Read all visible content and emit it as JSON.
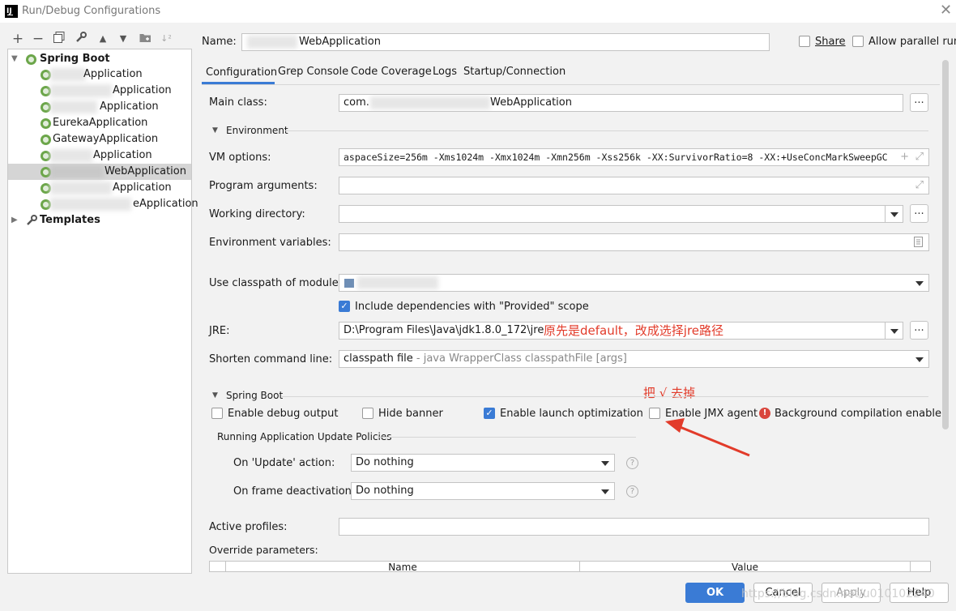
{
  "window": {
    "title": "Run/Debug Configurations"
  },
  "toolbar": {
    "add": "+",
    "remove": "−",
    "copy": "⧉",
    "edit": "🔧",
    "up": "▲",
    "down": "▼",
    "folder": "📁",
    "sort": "↓²"
  },
  "tree": {
    "spring_boot": "Spring Boot",
    "templates": "Templates",
    "items": [
      {
        "label": "Application"
      },
      {
        "label": "Application"
      },
      {
        "label": "Application"
      },
      {
        "label": "EurekaApplication"
      },
      {
        "label": "GatewayApplication"
      },
      {
        "label": "Application"
      },
      {
        "label": "WebApplication"
      },
      {
        "label": "Application"
      },
      {
        "label": "eApplication"
      }
    ]
  },
  "header": {
    "name_label": "Name:",
    "name_value": "WebApplication",
    "share_label": "Share",
    "parallel_label": "Allow parallel run"
  },
  "tabs": [
    "Configuration",
    "Grep Console",
    "Code Coverage",
    "Logs",
    "Startup/Connection"
  ],
  "form": {
    "main_class_label": "Main class:",
    "main_class_prefix": "com.",
    "main_class_suffix": "WebApplication",
    "environment_section": "Environment",
    "vm_options_label": "VM options:",
    "vm_options_value": "aspaceSize=256m -Xms1024m -Xmx1024m -Xmn256m -Xss256k -XX:SurvivorRatio=8 -XX:+UseConcMarkSweepGC",
    "program_args_label": "Program arguments:",
    "working_dir_label": "Working directory:",
    "env_vars_label": "Environment variables:",
    "classpath_label": "Use classpath of module:",
    "include_deps_label": "Include dependencies with \"Provided\" scope",
    "jre_label": "JRE:",
    "jre_value": "D:\\Program Files\\Java\\jdk1.8.0_172\\jre",
    "jre_note": "原先是default，改成选择jre路径",
    "shorten_label": "Shorten command line:",
    "shorten_value": "classpath file",
    "shorten_hint": " - java WrapperClass classpathFile [args]",
    "spring_section": "Spring Boot",
    "jmx_note": "把 √ 去掉",
    "enable_debug_label": "Enable debug output",
    "hide_banner_label": "Hide banner",
    "launch_opt_label": "Enable launch optimization",
    "jmx_label": "Enable JMX agent",
    "bg_compile_label": "Background compilation enabled",
    "policies_section": "Running Application Update Policies",
    "on_update_label": "On 'Update' action:",
    "on_update_value": "Do nothing",
    "on_frame_label": "On frame deactivation:",
    "on_frame_value": "Do nothing",
    "active_profiles_label": "Active profiles:",
    "override_label": "Override parameters:",
    "col_name": "Name",
    "col_value": "Value"
  },
  "buttons": {
    "ok": "OK",
    "cancel": "Cancel",
    "apply": "Apply",
    "help": "Help"
  },
  "watermark": "https://blog.csdn.net/u010102240",
  "colors": {
    "accent": "#3a7bd5",
    "note": "#e23b2a",
    "selected_row": "#d5d5d5"
  }
}
